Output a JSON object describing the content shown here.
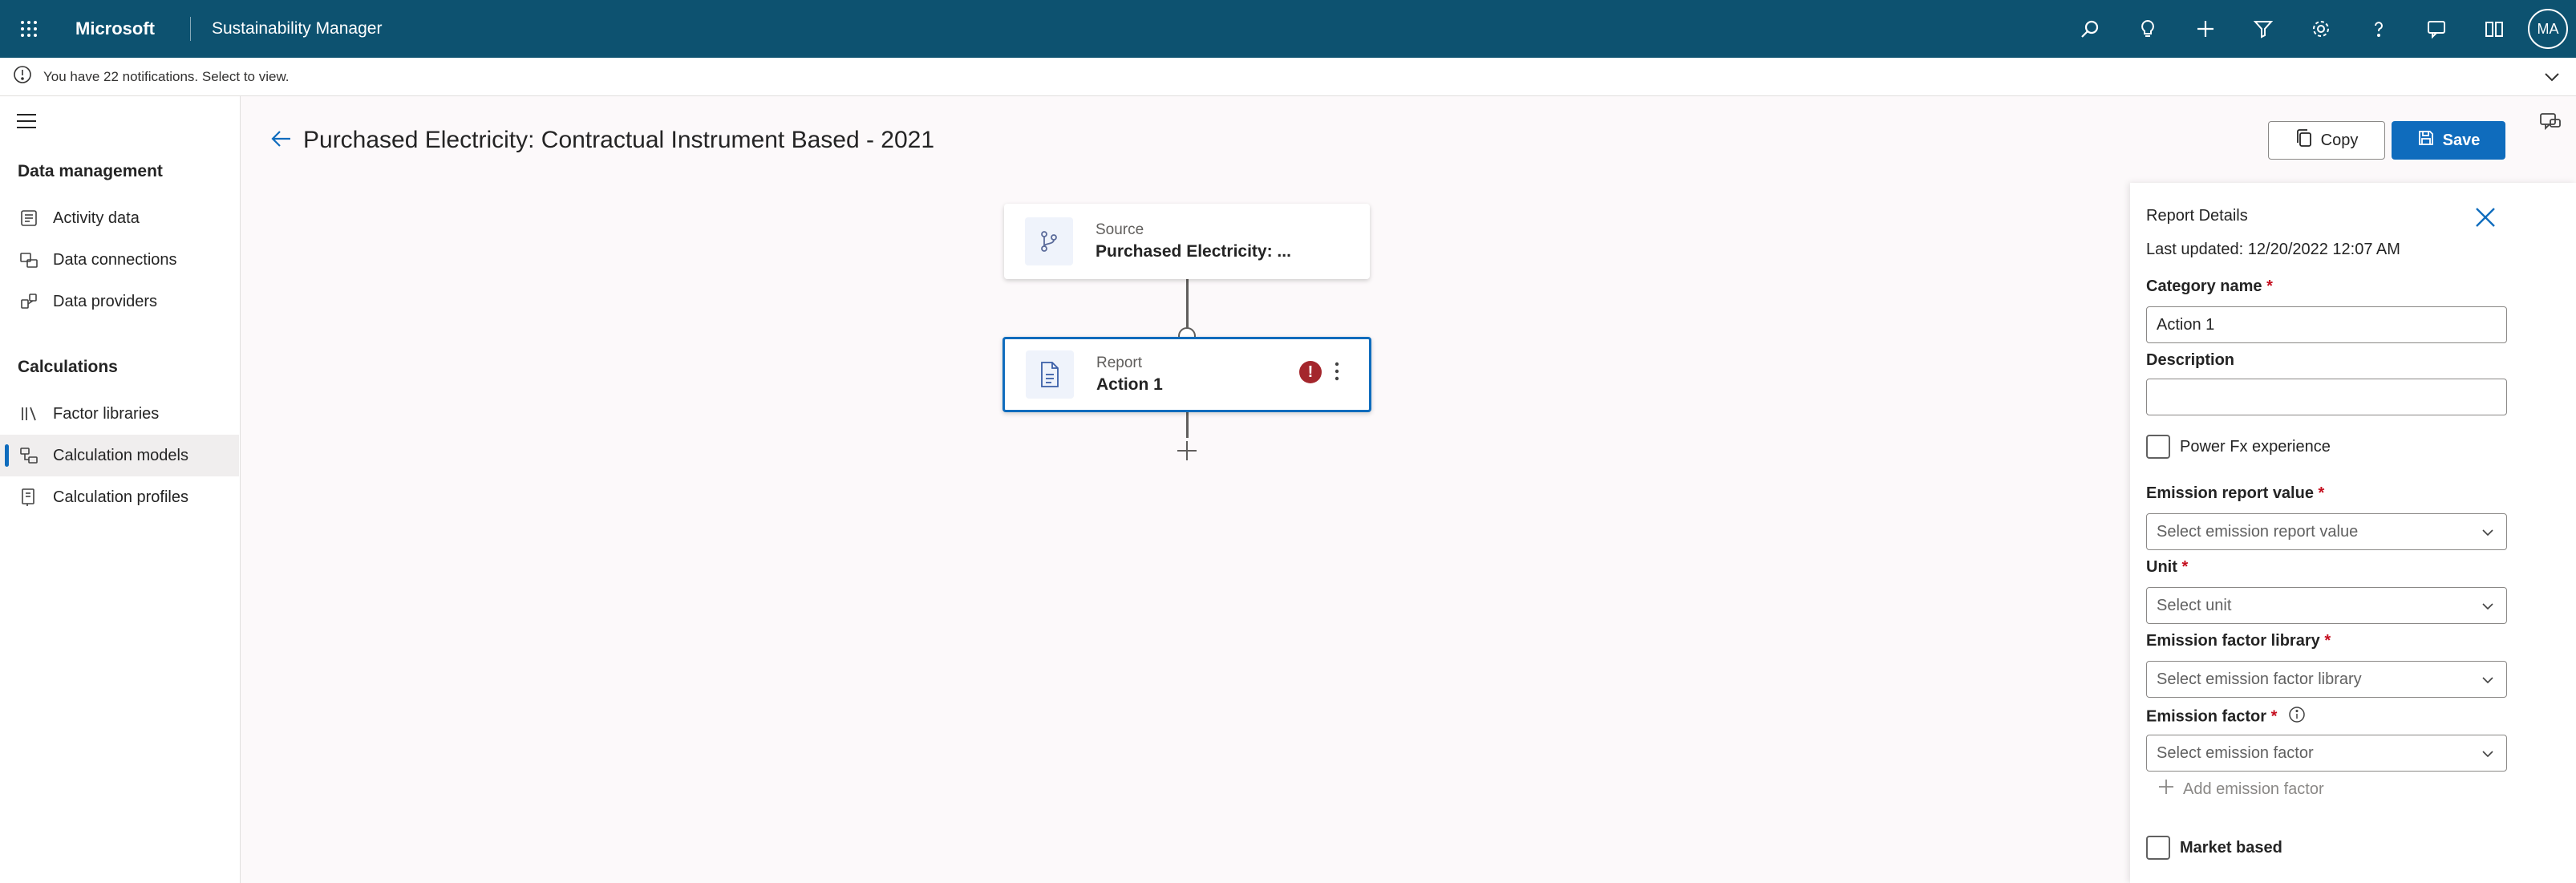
{
  "topbar": {
    "brand": "Microsoft",
    "app_name": "Sustainability Manager",
    "avatar_initials": "MA",
    "bg_color": "#0d5270",
    "icons": [
      "search-icon",
      "lightbulb-icon",
      "plus-icon",
      "filter-icon",
      "gear-icon",
      "help-icon",
      "chat-icon",
      "book-icon"
    ]
  },
  "notification": {
    "text": "You have 22 notifications. Select to view."
  },
  "sidebar": {
    "groups": [
      {
        "title": "Data management",
        "items": [
          {
            "label": "Activity data",
            "icon": "activity-data-icon"
          },
          {
            "label": "Data connections",
            "icon": "data-connections-icon"
          },
          {
            "label": "Data providers",
            "icon": "data-providers-icon"
          }
        ]
      },
      {
        "title": "Calculations",
        "items": [
          {
            "label": "Factor libraries",
            "icon": "factor-libraries-icon"
          },
          {
            "label": "Calculation models",
            "icon": "calculation-models-icon",
            "selected": true
          },
          {
            "label": "Calculation profiles",
            "icon": "calculation-profiles-icon"
          }
        ]
      }
    ]
  },
  "header": {
    "title": "Purchased Electricity: Contractual Instrument Based - 2021",
    "copy_label": "Copy",
    "save_label": "Save",
    "accent_color": "#0f6cbd"
  },
  "canvas": {
    "source_node": {
      "kind": "Source",
      "name": "Purchased Electricity: ..."
    },
    "report_node": {
      "kind": "Report",
      "name": "Action 1",
      "has_error": true
    }
  },
  "panel": {
    "title": "Report Details",
    "last_updated": "Last updated: 12/20/2022 12:07 AM",
    "category_name_label": "Category name",
    "category_name_value": "Action 1",
    "description_label": "Description",
    "description_value": "",
    "power_fx_label": "Power Fx experience",
    "emission_report_value_label": "Emission report value",
    "emission_report_value_placeholder": "Select emission report value",
    "unit_label": "Unit",
    "unit_placeholder": "Select unit",
    "emission_factor_library_label": "Emission factor library",
    "emission_factor_library_placeholder": "Select emission factor library",
    "emission_factor_label": "Emission factor",
    "emission_factor_placeholder": "Select emission factor",
    "add_emission_factor_label": "Add emission factor",
    "market_based_label": "Market based",
    "required_marker": "*"
  }
}
